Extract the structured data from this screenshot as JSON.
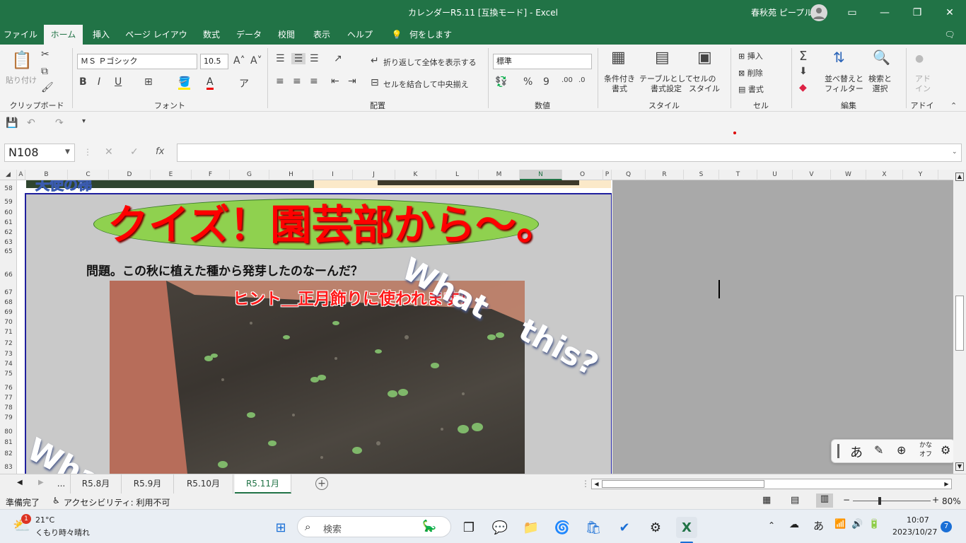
{
  "window": {
    "title": "カレンダーR5.11 [互換モード] - Excel",
    "user_name": "春秋苑 ピープル",
    "controls": {
      "ribbon_display": "▭",
      "minimize": "—",
      "restore": "❐",
      "close": "✕"
    }
  },
  "ribbon_tabs": [
    "ファイル",
    "ホーム",
    "挿入",
    "ページ レイアウト",
    "数式",
    "データ",
    "校閲",
    "表示",
    "ヘルプ",
    "何をしますか"
  ],
  "active_tab": "ホーム",
  "ribbon": {
    "clipboard": {
      "paste": "貼り付け",
      "label": "クリップボード"
    },
    "font": {
      "name": "ＭＳ Ｐゴシック",
      "size": "10.5",
      "bold": "B",
      "italic": "I",
      "underline": "U",
      "label": "フォント"
    },
    "alignment": {
      "wrap_text": "折り返して全体を表示する",
      "merge_center": "セルを結合して中央揃え",
      "label": "配置"
    },
    "number": {
      "format": "標準",
      "percent": "%",
      "comma": "9",
      "label": "数値"
    },
    "styles": {
      "conditional": "条件付き\n書式",
      "table": "テーブルとして\n書式設定",
      "cell_styles": "セルの\nスタイル",
      "label": "スタイル"
    },
    "cells": {
      "insert": "挿入",
      "delete": "削除",
      "format": "書式",
      "label": "セル"
    },
    "editing": {
      "sort_filter": "並べ替えと\nフィルター",
      "find_select": "検索と\n選択",
      "label": "編集"
    },
    "addins": {
      "addins": "アド\nイン",
      "label": "アドイン"
    }
  },
  "formula_bar": {
    "name_box": "N108",
    "cancel": "✕",
    "enter": "✓",
    "fx": "fx",
    "formula": ""
  },
  "columns": [
    "A",
    "B",
    "C",
    "D",
    "E",
    "F",
    "G",
    "H",
    "I",
    "J",
    "K",
    "L",
    "M",
    "N",
    "O",
    "P",
    "Q",
    "R",
    "S",
    "T",
    "U",
    "V",
    "W",
    "X",
    "Y"
  ],
  "selected_column": "N",
  "rows": [
    "58",
    "59",
    "60",
    "61",
    "62",
    "63",
    "65",
    "66",
    "67",
    "68",
    "69",
    "70",
    "71",
    "72",
    "73",
    "74",
    "75",
    "76",
    "77",
    "78",
    "79",
    "80",
    "81",
    "82",
    "83"
  ],
  "sheet_content": {
    "partial_title": "天使の梯",
    "banner": "クイズ！園芸部から～。",
    "question": "問題。この秋に植えた種から発芽したのなーんだ？",
    "hint": "ヒント＿正月飾りに使われます！",
    "deco_text_1": "What",
    "deco_text_2": "this?",
    "deco_text_3": "Wha"
  },
  "sheet_tabs": [
    "...",
    "R5.8月",
    "R5.9月",
    "R5.10月",
    "R5.11月"
  ],
  "active_sheet": "R5.11月",
  "status": {
    "ready": "準備完了",
    "accessibility": "アクセシビリティ: 利用不可",
    "zoom": "80%"
  },
  "ime_toolbar": {
    "mode": "あ",
    "kana_top": "かな",
    "kana_bottom": "オフ"
  },
  "taskbar": {
    "weather_temp": "21°C",
    "weather_desc": "くもり時々晴れ",
    "weather_badge": "1",
    "search_placeholder": "検索",
    "ime": "あ",
    "time": "10:07",
    "date": "2023/10/27",
    "notifications": "7"
  },
  "colors": {
    "excel_green": "#217346",
    "banner_fill": "#8fd14f",
    "banner_text": "#ff0000"
  }
}
